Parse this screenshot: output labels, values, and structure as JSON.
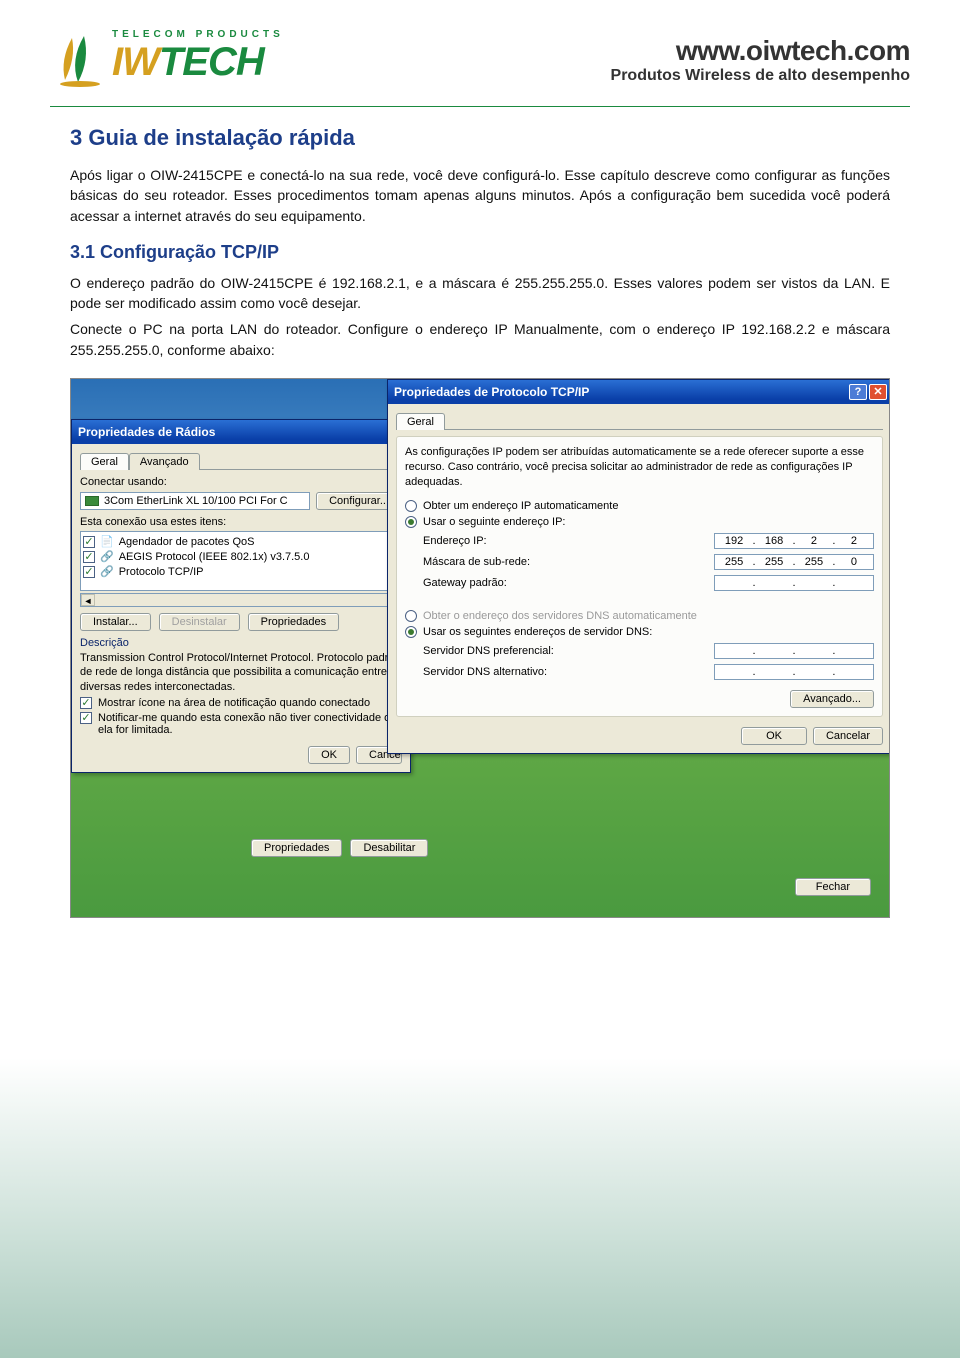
{
  "header": {
    "brand_iw": "IW",
    "brand_tech": "TECH",
    "brand_tag": "TELECOM PRODUCTS",
    "site_url": "www.oiwtech.com",
    "site_sub": "Produtos Wireless de alto desempenho"
  },
  "doc": {
    "h2": "3 Guia de instalação rápida",
    "p1": "Após ligar o OIW-2415CPE e conectá-lo na sua rede, você deve configurá-lo. Esse capítulo descreve como configurar as funções básicas do seu roteador. Esses procedimentos tomam apenas alguns minutos. Após a configuração bem sucedida você poderá acessar a internet através do seu equipamento.",
    "h3": "3.1 Configuração TCP/IP",
    "p2": "O endereço padrão do OIW-2415CPE é 192.168.2.1, e a máscara é 255.255.255.0. Esses valores podem ser vistos da LAN. E pode ser modificado assim como você desejar.",
    "p3": "Conecte o PC na porta LAN do roteador. Configure o endereço IP Manualmente, com o endereço IP 192.168.2.2 e máscara 255.255.255.0, conforme abaixo:"
  },
  "left_dialog": {
    "title": "Propriedades de Rádios",
    "tabs": [
      "Geral",
      "Avançado"
    ],
    "connect_label": "Conectar usando:",
    "adapter": "3Com EtherLink XL 10/100 PCI For C",
    "configure_btn": "Configurar...",
    "items_label": "Esta conexão usa estes itens:",
    "items": [
      "Agendador de pacotes QoS",
      "AEGIS Protocol (IEEE 802.1x) v3.7.5.0",
      "Protocolo TCP/IP"
    ],
    "install_btn": "Instalar...",
    "uninstall_btn": "Desinstalar",
    "props_btn": "Propriedades",
    "desc_hdr": "Descrição",
    "desc_text": "Transmission Control Protocol/Internet Protocol. Protocolo padrão de rede de longa distância que possibilita a comunicação entre diversas redes interconectadas.",
    "chk_tray": "Mostrar ícone na área de notificação quando conectado",
    "chk_notify": "Notificar-me quando esta conexão não tiver conectividade ou ela for limitada.",
    "ok": "OK",
    "cancel": "Cancelar",
    "props": "Propriedades",
    "disable": "Desabilitar",
    "close": "Fechar"
  },
  "right_dialog": {
    "title": "Propriedades de Protocolo TCP/IP",
    "tab": "Geral",
    "intro": "As configurações IP podem ser atribuídas automaticamente se a rede oferecer suporte a esse recurso. Caso contrário, você precisa solicitar ao administrador de rede as configurações IP adequadas.",
    "radio_auto_ip": "Obter um endereço IP automaticamente",
    "radio_manual_ip": "Usar o seguinte endereço IP:",
    "ip_label": "Endereço IP:",
    "ip_value": [
      "192",
      "168",
      "2",
      "2"
    ],
    "mask_label": "Máscara de sub-rede:",
    "mask_value": [
      "255",
      "255",
      "255",
      "0"
    ],
    "gw_label": "Gateway padrão:",
    "gw_value": [
      "",
      "",
      "",
      ""
    ],
    "radio_auto_dns": "Obter o endereço dos servidores DNS automaticamente",
    "radio_manual_dns": "Usar os seguintes endereços de servidor DNS:",
    "dns1_label": "Servidor DNS preferencial:",
    "dns2_label": "Servidor DNS alternativo:",
    "adv_btn": "Avançado...",
    "ok": "OK",
    "cancel": "Cancelar"
  }
}
